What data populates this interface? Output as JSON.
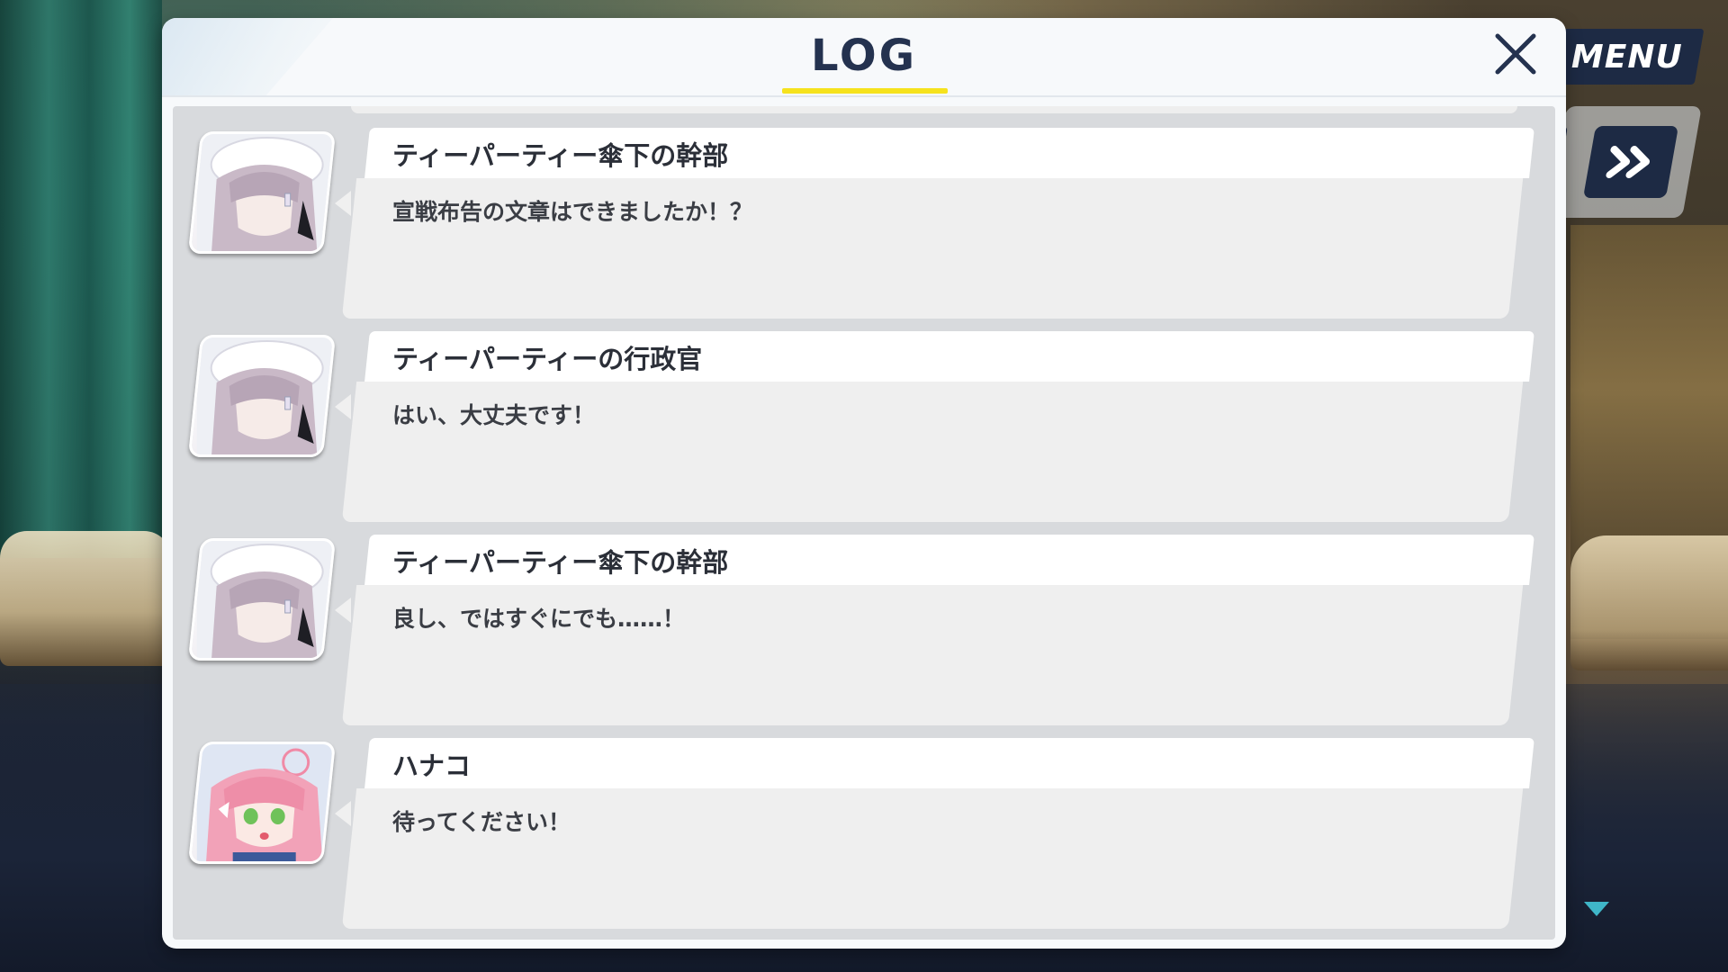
{
  "menu": {
    "label": "MENU"
  },
  "log": {
    "title": "LOG",
    "close_icon": "close-icon",
    "entries": [
      {
        "speaker": "ティーパーティー傘下の幹部",
        "message": "宣戦布告の文章はできましたか！？",
        "portrait": "grey-haired-student-portrait"
      },
      {
        "speaker": "ティーパーティーの行政官",
        "message": "はい、大丈夫です！",
        "portrait": "grey-haired-student-portrait"
      },
      {
        "speaker": "ティーパーティー傘下の幹部",
        "message": "良し、ではすぐにでも……！",
        "portrait": "grey-haired-student-portrait"
      },
      {
        "speaker": "ハナコ",
        "message": "待ってください！",
        "portrait": "pink-haired-hanako-portrait"
      }
    ]
  },
  "colors": {
    "accent_underline": "#f6e21d",
    "title_text": "#24324f",
    "button_bg": "#1d2a44",
    "scroll_arrow": "#3fb6c8"
  }
}
